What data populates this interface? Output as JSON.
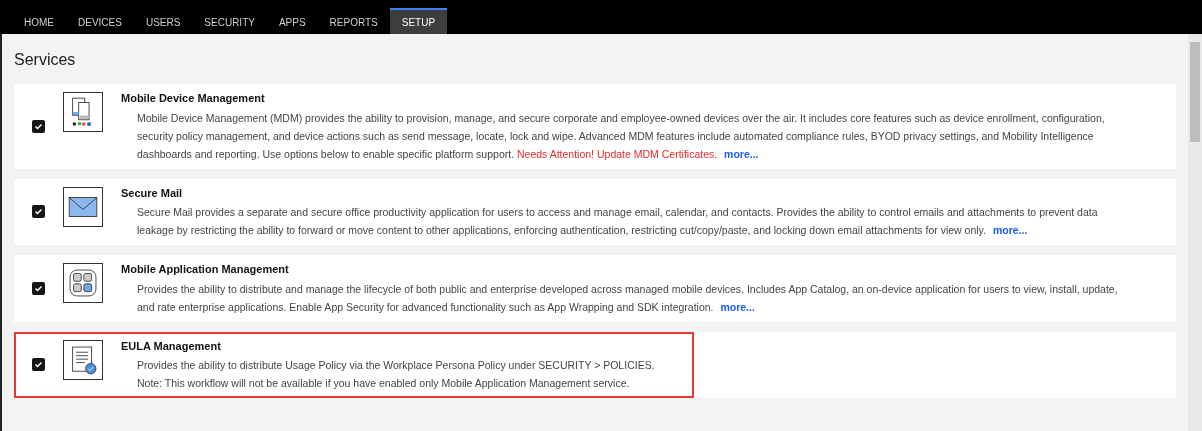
{
  "tabs": [
    {
      "label": "HOME",
      "selected": false
    },
    {
      "label": "DEVICES",
      "selected": false
    },
    {
      "label": "USERS",
      "selected": false
    },
    {
      "label": "SECURITY",
      "selected": false
    },
    {
      "label": "APPS",
      "selected": false
    },
    {
      "label": "REPORTS",
      "selected": false
    },
    {
      "label": "SETUP",
      "selected": true
    }
  ],
  "page_title": "Services",
  "services": [
    {
      "kind": "devices",
      "title": "Mobile Device Management",
      "checked": true,
      "highlighted": false,
      "description": "Mobile Device Management (MDM) provides the ability to provision, manage, and secure corporate and employee-owned devices over the air. It includes core features such as device enrollment, configuration, security policy management, and device actions such as send message, locate, lock and wipe. Advanced MDM features include automated compliance rules, BYOD privacy settings, and Mobility Intelligence dashboards and reporting. Use options below to enable specific platform support.",
      "warning": "Needs Attention! Update MDM Certificates.",
      "more_link": "more..."
    },
    {
      "kind": "mail",
      "title": "Secure Mail",
      "checked": true,
      "highlighted": false,
      "description": "Secure Mail provides a separate and secure office productivity application for users to access and manage email, calendar, and contacts. Provides the ability to control emails and attachments to prevent data leakage by restricting the ability to forward or move content to other applications, enforcing authentication, restricting cut/copy/paste, and locking down email attachments for view only.",
      "more_link": "more..."
    },
    {
      "kind": "apps",
      "title": "Mobile Application Management",
      "checked": true,
      "highlighted": false,
      "description": "Provides the ability to distribute and manage the lifecycle of both public and enterprise developed across managed mobile devices. Includes App Catalog, an on-device application for users to view, install, update, and rate enterprise applications. Enable App Security for advanced functionality such as App Wrapping and SDK integration.",
      "more_link": "more..."
    },
    {
      "kind": "document",
      "title": "EULA Management",
      "checked": true,
      "highlighted": true,
      "description": "Provides the ability to distribute Usage Policy via the Workplace Persona Policy under SECURITY > POLICIES.",
      "note": "Note: This workflow will not be available if you have enabled only Mobile Application Management service."
    }
  ]
}
